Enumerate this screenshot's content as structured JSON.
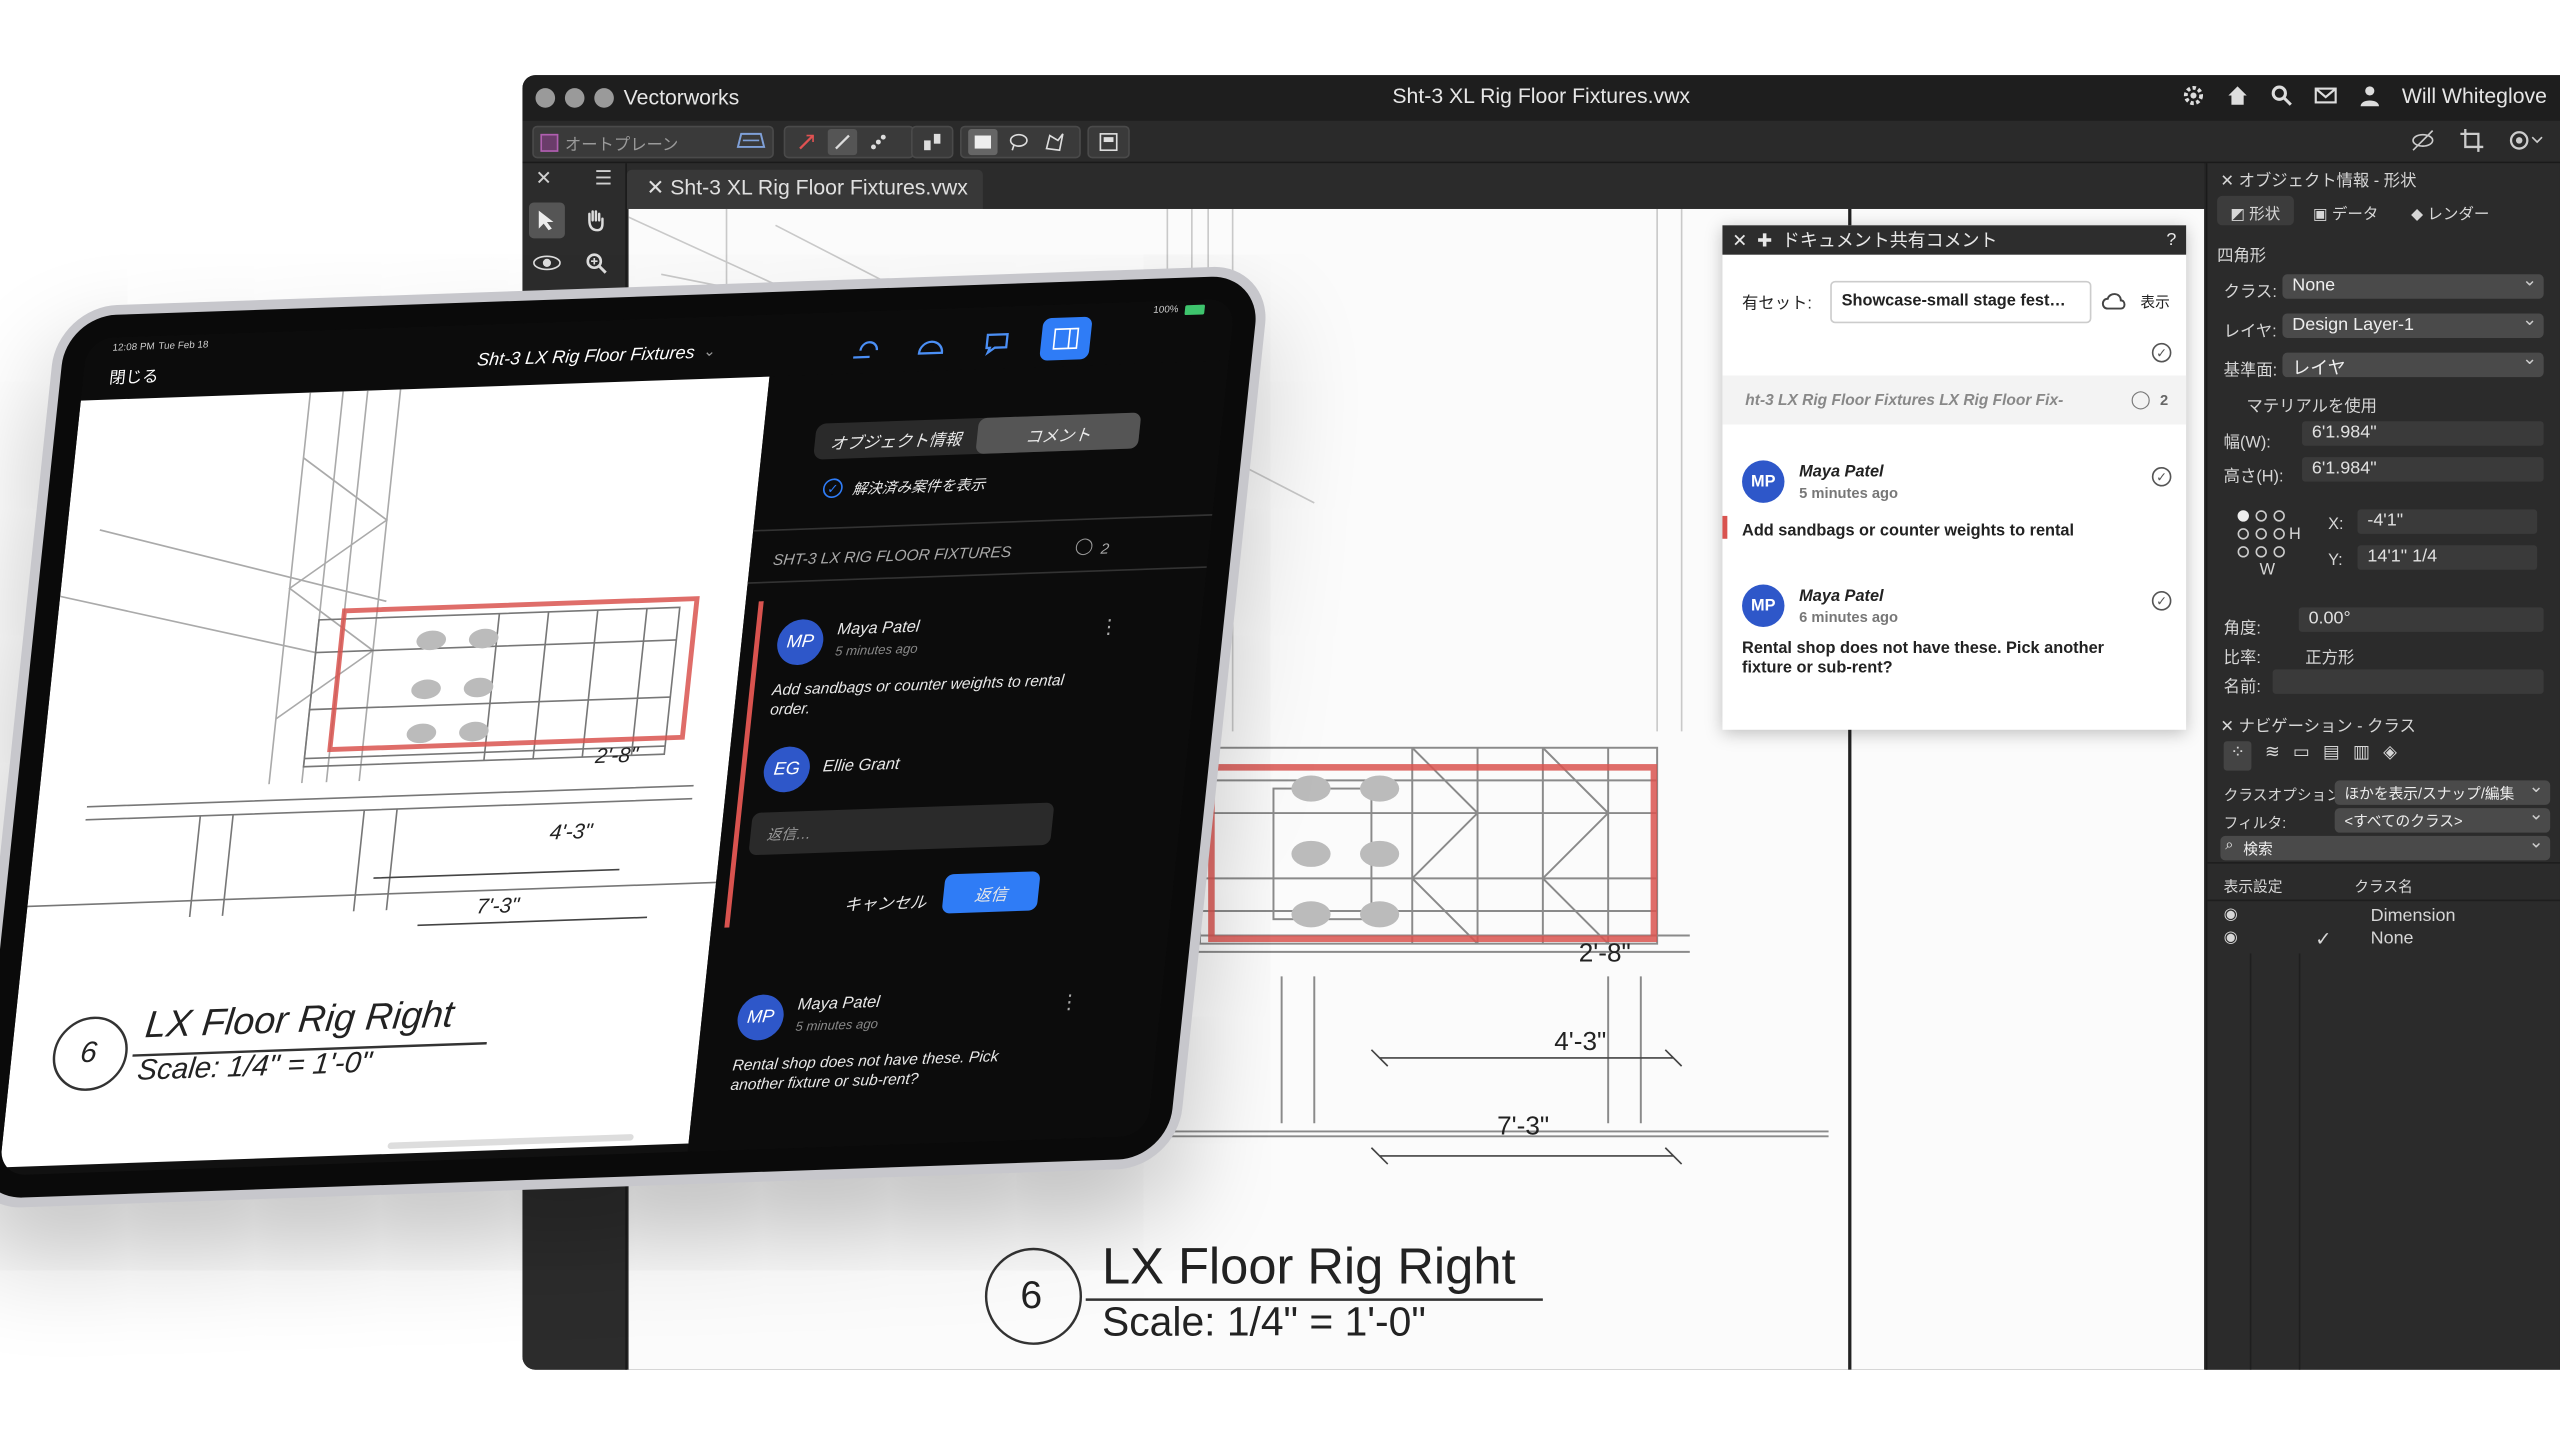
{
  "window": {
    "app_name": "Vectorworks",
    "doc_title": "Sht-3 XL Rig Floor Fixtures.vwx",
    "user_name": "Will Whiteglove",
    "toolbar_planar": "オートプレーン"
  },
  "tab": {
    "label": "Sht-3 XL Rig Floor Fixtures.vwx"
  },
  "drawing": {
    "dims": [
      "2'-8\"",
      "4'-3\"",
      "7'-3\""
    ],
    "title_number": "6",
    "title": "LX Floor Rig Right",
    "scale": "Scale: 1/4\" = 1'-0\""
  },
  "comment_panel": {
    "header": "ドキュメント共有コメント",
    "help": "?",
    "share_set_label": "有セット:",
    "share_set_value": "Showcase-small stage fest…",
    "show_label": "表示",
    "group_title": "ht-3 LX Rig Floor Fixtures LX Rig Floor Fix-",
    "group_count": "2",
    "comments": [
      {
        "initials": "MP",
        "author": "Maya Patel",
        "time": "5 minutes ago",
        "text": "Add sandbags or counter weights to rental"
      },
      {
        "initials": "MP",
        "author": "Maya Patel",
        "time": "6 minutes ago",
        "text": "Rental shop does not have these. Pick another fixture or sub-rent?"
      }
    ]
  },
  "inspector": {
    "title": "オブジェクト情報 - 形状",
    "tabs": [
      "形状",
      "データ",
      "レンダー"
    ],
    "shape_type": "四角形",
    "class_label": "クラス:",
    "class_value": "None",
    "layer_label": "レイヤ:",
    "layer_value": "Design Layer-1",
    "plane_label": "基準面:",
    "plane_value": "レイヤ",
    "material_label": "マテリアルを使用",
    "width_label": "幅(W):",
    "width_value": "6'1.984\"",
    "height_label": "高さ(H):",
    "height_value": "6'1.984\"",
    "h_label": "H",
    "w_label": "W",
    "x_label": "X:",
    "x_value": "-4'1\"",
    "y_label": "Y:",
    "y_value": "14'1\" 1/4",
    "angle_label": "角度:",
    "angle_value": "0.00°",
    "ratio_label": "比率:",
    "ratio_value": "正方形",
    "name_label": "名前:",
    "nav_title": "ナビゲーション - クラス",
    "class_option_label": "クラスオプション:",
    "class_option_value": "ほかを表示/スナップ/編集",
    "filter_label": "フィルタ:",
    "filter_value": "<すべてのクラス>",
    "search_placeholder": "検索",
    "col_display": "表示設定",
    "col_classname": "クラス名",
    "classes": [
      "Dimension",
      "None"
    ]
  },
  "ipad": {
    "time": "12:08 PM",
    "date": "Tue Feb 18",
    "battery": "100%",
    "close": "閉じる",
    "doc_title": "Sht-3 LX Rig Floor Fixtures",
    "seg_info": "オブジェクト情報",
    "seg_comment": "コメント",
    "show_resolved": "解決済み案件を表示",
    "group_title": "SHT-3 LX RIG FLOOR FIXTURES",
    "group_count": "2",
    "c1_initials": "MP",
    "c1_author": "Maya Patel",
    "c1_time": "5 minutes ago",
    "c1_text": "Add sandbags or counter weights to rental order.",
    "reply_initials": "EG",
    "reply_author": "Ellie Grant",
    "reply_placeholder": "返信…",
    "cancel": "キャンセル",
    "send": "返信",
    "c2_initials": "MP",
    "c2_author": "Maya Patel",
    "c2_time": "5 minutes ago",
    "c2_text": "Rental shop does not have these. Pick another fixture or sub-rent?",
    "dims": [
      "2'-8\"",
      "4'-3\"",
      "7'-3\""
    ],
    "title_number": "6",
    "title": "LX Floor Rig Right",
    "scale": "Scale: 1/4\" = 1'-0\""
  },
  "colors": {
    "accent": "#2e57c9",
    "highlight": "#d9534f",
    "ipad_button": "#2f7cf6"
  }
}
